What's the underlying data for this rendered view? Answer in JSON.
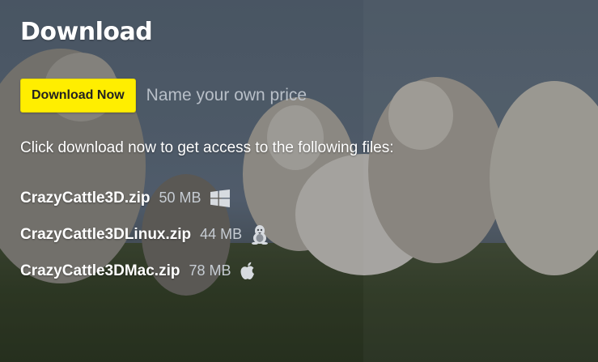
{
  "heading": "Download",
  "download_button": "Download Now",
  "price_link": "Name your own price",
  "intro": "Click download now to get access to the following files:",
  "files": [
    {
      "name": "CrazyCattle3D.zip",
      "size": "50 MB",
      "platform_icon": "windows-icon"
    },
    {
      "name": "CrazyCattle3DLinux.zip",
      "size": "44 MB",
      "platform_icon": "linux-icon"
    },
    {
      "name": "CrazyCattle3DMac.zip",
      "size": "78 MB",
      "platform_icon": "apple-icon"
    }
  ],
  "colors": {
    "button_bg": "#ffee00",
    "text": "#ffffff",
    "muted_text": "#b8bfc8"
  }
}
